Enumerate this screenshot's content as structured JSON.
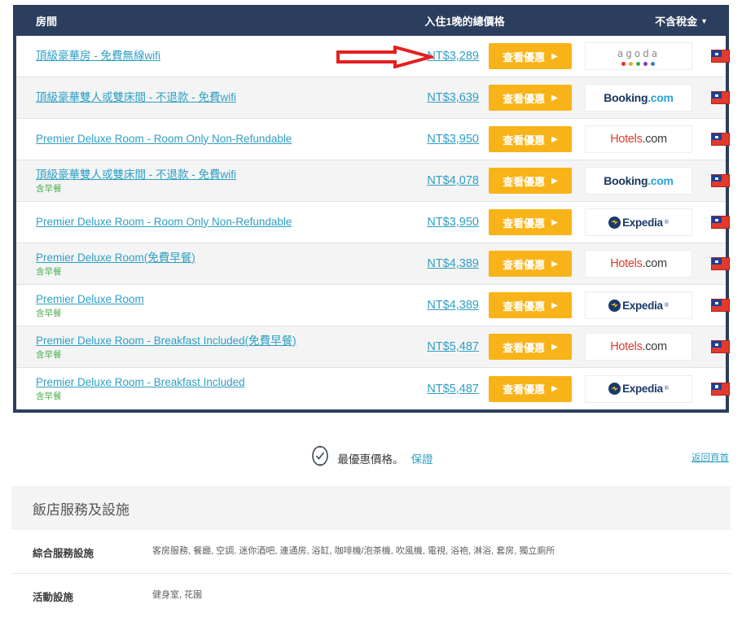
{
  "table": {
    "header": {
      "room_col": "房間",
      "price_col": "入住1晚的總價格",
      "tax_toggle": "不含稅金",
      "caret": "▼"
    },
    "cta_label": "查看優惠",
    "cta_arrow": "▶",
    "flag_name": "taiwan-flag",
    "rows": [
      {
        "room": "頂級豪華房 - 免費無線wifi",
        "meal": "",
        "price": "NT$3,289",
        "provider": "agoda",
        "provider_text": "agoda"
      },
      {
        "room": "頂級豪華雙人或雙床間 - 不退款 - 免費wifi",
        "meal": "",
        "price": "NT$3,639",
        "provider": "booking",
        "provider_text": "Booking.com"
      },
      {
        "room": "Premier Deluxe Room - Room Only Non-Refundable",
        "meal": "",
        "price": "NT$3,950",
        "provider": "hotels",
        "provider_text": "Hotels.com"
      },
      {
        "room": "頂級豪華雙人或雙床間 - 不退款 - 免費wifi",
        "meal": "含早餐",
        "price": "NT$4,078",
        "provider": "booking",
        "provider_text": "Booking.com"
      },
      {
        "room": "Premier Deluxe Room - Room Only Non-Refundable",
        "meal": "",
        "price": "NT$3,950",
        "provider": "expedia",
        "provider_text": "Expedia"
      },
      {
        "room": "Premier Deluxe Room(免費早餐)",
        "meal": "含早餐",
        "price": "NT$4,389",
        "provider": "hotels",
        "provider_text": "Hotels.com"
      },
      {
        "room": "Premier Deluxe Room",
        "meal": "含早餐",
        "price": "NT$4,389",
        "provider": "expedia",
        "provider_text": "Expedia"
      },
      {
        "room": "Premier Deluxe Room - Breakfast Included(免費早餐)",
        "meal": "含早餐",
        "price": "NT$5,487",
        "provider": "hotels",
        "provider_text": "Hotels.com"
      },
      {
        "room": "Premier Deluxe Room - Breakfast Included",
        "meal": "含早餐",
        "price": "NT$5,487",
        "provider": "expedia",
        "provider_text": "Expedia"
      }
    ]
  },
  "annotation": {
    "type": "red-arrow-right",
    "color": "#e41f20",
    "points_to": "NT$3,289"
  },
  "guarantee": {
    "text": "最優惠價格。",
    "link": "保證",
    "badge": "check-circle-icon"
  },
  "back_to_top": "返回頁首",
  "facilities": {
    "title": "飯店服務及設施",
    "rows": [
      {
        "label": "綜合服務設施",
        "value": "客房服務, 餐廳, 空調, 迷你酒吧, 連通房, 浴缸, 咖啡機/泡茶機, 吹風機, 電視, 浴袍, 淋浴, 套房, 獨立廁所"
      },
      {
        "label": "活動設施",
        "value": "健身室, 花園"
      }
    ]
  },
  "colors": {
    "header_navy": "#2c3e5d",
    "cta_yellow": "#f8b319",
    "link_blue": "#2e9fc4",
    "meal_green": "#4caf50",
    "arrow_red": "#e41f20"
  },
  "agoda_dot_colors": [
    "#e0332c",
    "#f0a428",
    "#38a85a",
    "#8a38b0",
    "#2f7fd0"
  ]
}
